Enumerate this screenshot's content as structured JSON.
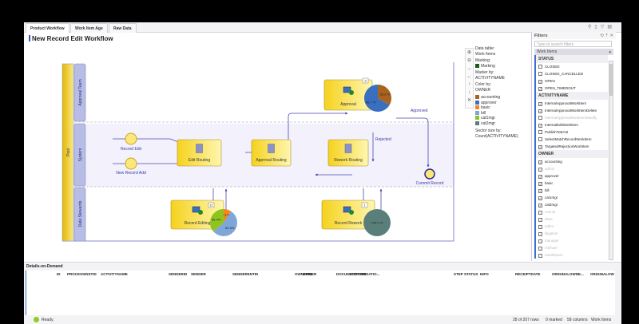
{
  "tabs": [
    {
      "label": "Product Workflow",
      "active": true
    },
    {
      "label": "Work Item Age"
    },
    {
      "label": "Raw Data"
    }
  ],
  "page_title": "New Record Edit Workflow",
  "diagram": {
    "pool": "Pool",
    "lanes": [
      "Approval Team",
      "System",
      "Data Stewards"
    ],
    "events": [
      "Record Edit",
      "New Record Add",
      "Commit Record"
    ],
    "tasks": [
      "Edit Routing",
      "Approval Routing",
      "Rework Routing",
      "Approval",
      "Record Editing",
      "Record Rework"
    ],
    "flow_labels": {
      "approved": "Approved",
      "rejected": "Rejected"
    },
    "pies": [
      {
        "task": "Record Editing",
        "count": "11",
        "slices": [
          {
            "owner": "basic",
            "pct": 9.1,
            "label": "9.1%"
          },
          {
            "owner": "bill",
            "pct": 54.5,
            "label": "54.5%"
          },
          {
            "owner": "cat1mgr",
            "pct": 36.4,
            "label": "36.4%"
          }
        ]
      },
      {
        "task": "Approval",
        "count": "3",
        "slices": [
          {
            "owner": "accounting",
            "pct": 33.3,
            "label": "33.3 %"
          },
          {
            "owner": "approver",
            "pct": 66.7,
            "label": "66.7 %"
          }
        ]
      },
      {
        "task": "Record Rework",
        "count": "1",
        "slices": [
          {
            "owner": "cat2mgr",
            "pct": 100,
            "label": "100.0 %"
          }
        ]
      }
    ]
  },
  "legend": {
    "data_table_label": "Data table:",
    "data_table": "Work Items",
    "marking_label": "Marking:",
    "marking": "Marking",
    "marking_color": "#1e5a1e",
    "marker_by_label": "Marker by:",
    "marker_by": "ACTIVITYNAME",
    "color_by_label": "Color by:",
    "color_by": "OWNER",
    "colors": [
      {
        "name": "accounting",
        "color": "#a8641e"
      },
      {
        "name": "approver",
        "color": "#3a6fc0"
      },
      {
        "name": "basic",
        "color": "#f08a1e"
      },
      {
        "name": "bill",
        "color": "#7fa6d8"
      },
      {
        "name": "cat1mgr",
        "color": "#8fc41e"
      },
      {
        "name": "cat2mgr",
        "color": "#5a7f7a"
      }
    ],
    "sector_label": "Sector size by:",
    "sector": "Count(ACTIVITYNAME)"
  },
  "filters": {
    "title": "Filters",
    "search_placeholder": "Type to search filters",
    "table": "Work Items",
    "groups": [
      {
        "title": "STATUS",
        "items": [
          {
            "label": "CLOSED",
            "checked": false
          },
          {
            "label": "CLOSED_CANCELLED",
            "checked": false
          },
          {
            "label": "OPEN",
            "checked": true
          },
          {
            "label": "OPEN_TIMEDOUT",
            "checked": true
          }
        ]
      },
      {
        "title": "ACTIVITYNAME",
        "items": [
          {
            "label": "InternalApprovalWorkItem",
            "checked": true
          },
          {
            "label": "InternalApprovalWorkItemDelete",
            "checked": true
          },
          {
            "label": "InternalApprovalWorkItemModify",
            "checked": false,
            "dim": true
          },
          {
            "label": "InternalEditWorkItem",
            "checked": true
          },
          {
            "label": "PublishToEAI2",
            "checked": false
          },
          {
            "label": "SelectMatchRecordWorkItem",
            "checked": false
          },
          {
            "label": "TargetedRejectionWorkItem",
            "checked": true
          }
        ]
      },
      {
        "title": "OWNER",
        "items": [
          {
            "label": "accounting",
            "checked": true
          },
          {
            "label": "admin",
            "checked": true,
            "dim": true
          },
          {
            "label": "approver",
            "checked": true
          },
          {
            "label": "basic",
            "checked": true
          },
          {
            "label": "bill",
            "checked": true
          },
          {
            "label": "cat1mgr",
            "checked": true
          },
          {
            "label": "cat2mgr",
            "checked": true
          },
          {
            "label": "connie",
            "checked": true,
            "dim": true
          },
          {
            "label": "dave",
            "checked": true,
            "dim": true
          },
          {
            "label": "editor",
            "checked": true,
            "dim": true
          },
          {
            "label": "litigation",
            "checked": true,
            "dim": true
          },
          {
            "label": "manager",
            "checked": true,
            "dim": true
          },
          {
            "label": "michael",
            "checked": true,
            "dim": true
          },
          {
            "label": "retailimport",
            "checked": true,
            "dim": true
          }
        ]
      }
    ]
  },
  "details": {
    "title": "Details-on-Demand",
    "columns": [
      "ID",
      "PROCESSINSTID",
      "ACTIVITYNAME",
      "SENDERID",
      "SENDER",
      "SENDERENTID",
      "OWNERID",
      "OWNER",
      "DOCUMENTTYPE",
      "CONVERSATIO...",
      "STEP",
      "STATUS",
      "INFO",
      "RECEIPTDATE",
      "ORIGINALOWNE...",
      "ORIGINALOW"
    ]
  },
  "status": {
    "text": "Ready.",
    "rows": "28 of 207 rows",
    "marked": "0 marked",
    "columns": "58 columns",
    "table": "Work Items"
  }
}
